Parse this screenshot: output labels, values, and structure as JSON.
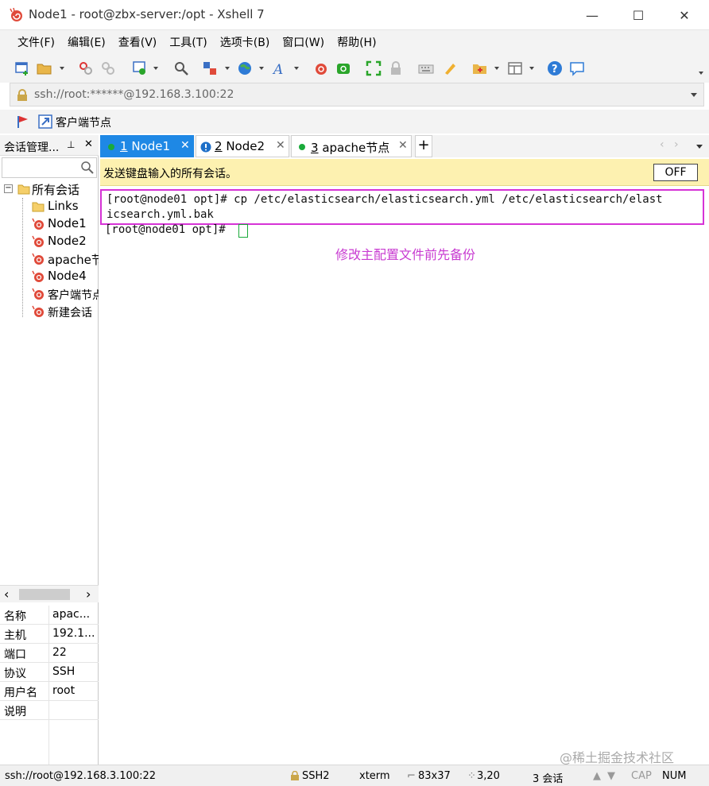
{
  "window": {
    "title": "Node1 - root@zbx-server:/opt - Xshell 7",
    "minimize": "—",
    "maximize": "☐",
    "close": "✕"
  },
  "menu": [
    "文件(F)",
    "编辑(E)",
    "查看(V)",
    "工具(T)",
    "选项卡(B)",
    "窗口(W)",
    "帮助(H)"
  ],
  "address": {
    "value": "ssh://root:******@192.168.3.100:22"
  },
  "quickbar": {
    "label": "客户端节点"
  },
  "sidebar": {
    "title": "会话管理...",
    "pin": "⊥",
    "close": "✕",
    "root": "所有会话",
    "items": [
      "Links",
      "Node1",
      "Node2",
      "apache节点",
      "Node4",
      "客户端节点",
      "新建会话"
    ],
    "scroll_left": "‹",
    "scroll_right": "›"
  },
  "properties": [
    {
      "key": "名称",
      "value": "apac..."
    },
    {
      "key": "主机",
      "value": "192.1..."
    },
    {
      "key": "端口",
      "value": "22"
    },
    {
      "key": "协议",
      "value": "SSH"
    },
    {
      "key": "用户名",
      "value": "root"
    },
    {
      "key": "说明",
      "value": ""
    }
  ],
  "tabs": [
    {
      "num": "1",
      "label": "Node1",
      "close": "✕"
    },
    {
      "num": "2",
      "label": "Node2",
      "close": "✕"
    },
    {
      "num": "3",
      "label": "apache节点",
      "close": "✕"
    }
  ],
  "add_tab": "+",
  "notice": {
    "text": "发送键盘输入的所有会话。",
    "off": "OFF"
  },
  "terminal": {
    "line1": "[root@node01 opt]# cp /etc/elasticsearch/elasticsearch.yml /etc/elasticsearch/elast",
    "line2": "icsearch.yml.bak",
    "line3": "[root@node01 opt]# ",
    "annotation": "修改主配置文件前先备份",
    "watermark": "@稀土掘金技术社区"
  },
  "status": {
    "address": "ssh://root@192.168.3.100:22",
    "protocol": "SSH2",
    "term": "xterm",
    "size": "83x37",
    "pos": "3,20",
    "sessions": "3 会话",
    "cap": "CAP",
    "num": "NUM"
  },
  "colors": {
    "accent": "#1e88e5",
    "highlight_box": "#d633d6",
    "annotation": "#c83bd1",
    "notice_bg": "#fdf1b0",
    "connected": "#1aaa3a"
  }
}
